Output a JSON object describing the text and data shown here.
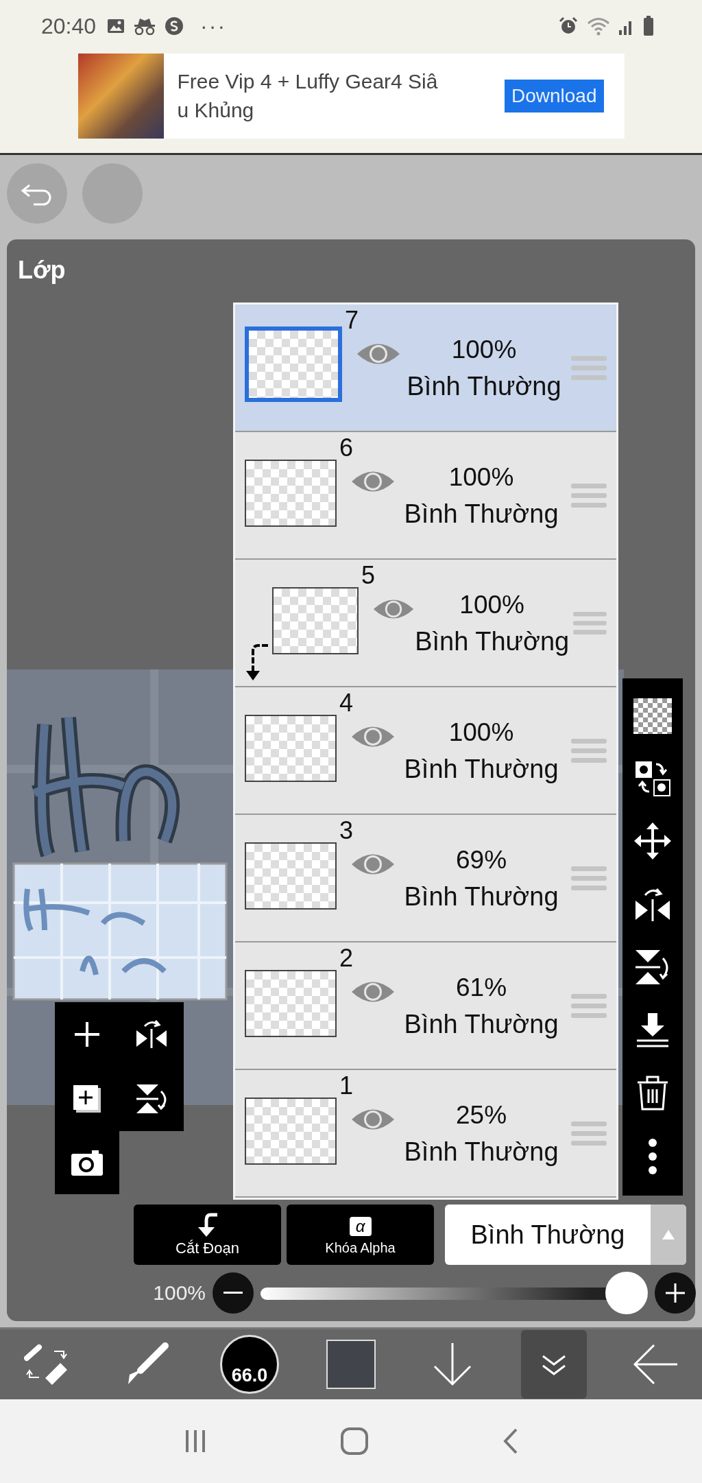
{
  "status_bar": {
    "time": "20:40",
    "more": "···"
  },
  "ad": {
    "title_lines": [
      "Free Vip 4 + Luffy Gear4 Siâ",
      "u Khủng"
    ],
    "button": "Download"
  },
  "panel": {
    "title": "Lớp"
  },
  "layers": [
    {
      "number": "7",
      "opacity": "100%",
      "blend": "Bình Thường",
      "selected": true,
      "visible": true,
      "kind": "normal"
    },
    {
      "number": "6",
      "opacity": "100%",
      "blend": "Bình Thường",
      "selected": false,
      "visible": true,
      "kind": "normal"
    },
    {
      "number": "5",
      "opacity": "100%",
      "blend": "Bình Thường",
      "selected": false,
      "visible": true,
      "kind": "clipped"
    },
    {
      "number": "4",
      "opacity": "100%",
      "blend": "Bình Thường",
      "selected": false,
      "visible": true,
      "kind": "normal"
    },
    {
      "number": "3",
      "opacity": "69%",
      "blend": "Bình Thường",
      "selected": false,
      "visible": true,
      "kind": "normal"
    },
    {
      "number": "2",
      "opacity": "61%",
      "blend": "Bình Thường",
      "selected": false,
      "visible": true,
      "kind": "normal"
    },
    {
      "number": "1",
      "opacity": "25%",
      "blend": "Bình Thường",
      "selected": false,
      "visible": true,
      "kind": "normal"
    }
  ],
  "layer_tools": [
    {
      "kind": "transparency"
    },
    {
      "kind": "swap"
    },
    {
      "kind": "move"
    },
    {
      "kind": "flip-h"
    },
    {
      "kind": "flip-v"
    },
    {
      "kind": "merge-down"
    },
    {
      "kind": "delete"
    },
    {
      "kind": "more"
    }
  ],
  "quick_tools": [
    {
      "kind": "add"
    },
    {
      "kind": "flip-h"
    },
    {
      "kind": "add-layer"
    },
    {
      "kind": "flip-v"
    },
    {
      "kind": "camera"
    }
  ],
  "actions": [
    {
      "kind": "clip",
      "label": "Cắt Đoạn"
    },
    {
      "kind": "alpha",
      "label": "Khóa Alpha",
      "glyph": "α"
    }
  ],
  "blend_mode": {
    "value": "Bình Thường"
  },
  "opacity": {
    "reading": "100%",
    "level": 1
  },
  "toolbar": [
    {
      "kind": "swap",
      "selected": false
    },
    {
      "kind": "brush",
      "selected": false
    },
    {
      "kind": "size",
      "label": "66.0",
      "selected": false
    },
    {
      "kind": "color",
      "selected": false
    },
    {
      "kind": "down",
      "selected": false
    },
    {
      "kind": "collapse",
      "selected": true
    },
    {
      "kind": "back",
      "selected": false
    }
  ]
}
